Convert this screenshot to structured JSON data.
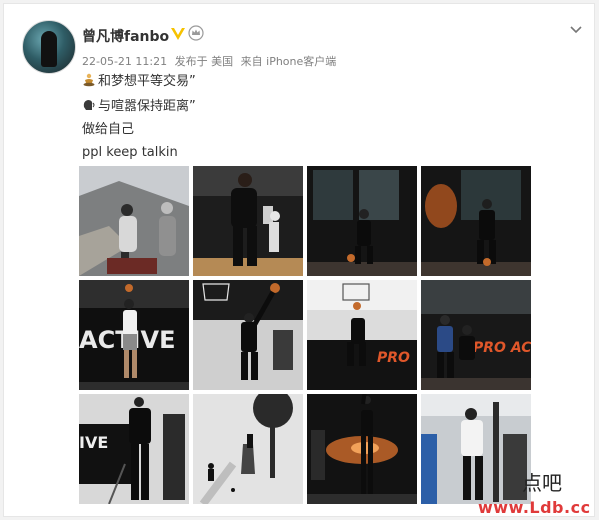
{
  "post": {
    "username": "曾凡博fanbo",
    "meta": {
      "date": "22-05-21 11:21",
      "published_from": "发布于 美国",
      "source": "来自 iPhone客户端"
    },
    "lines": [
      {
        "icon": "meditation-emoji-icon",
        "text": "和梦想平等交易”"
      },
      {
        "icon": "speaking-head-emoji-icon",
        "text": "与喧嚣保持距离”"
      },
      {
        "icon": "",
        "text": "做给自己"
      },
      {
        "icon": "",
        "text": "ppl keep talkin"
      }
    ],
    "photos": [
      {
        "id": "photo-1",
        "text": ""
      },
      {
        "id": "photo-2",
        "text": ""
      },
      {
        "id": "photo-3",
        "text": ""
      },
      {
        "id": "photo-4",
        "text": ""
      },
      {
        "id": "photo-5",
        "text": "ACTIVE"
      },
      {
        "id": "photo-6",
        "text": ""
      },
      {
        "id": "photo-7",
        "text": "PRO"
      },
      {
        "id": "photo-8",
        "text": "PRO AC"
      },
      {
        "id": "photo-9",
        "text": "IVE"
      },
      {
        "id": "photo-10",
        "text": ""
      },
      {
        "id": "photo-11",
        "text": ""
      },
      {
        "id": "photo-12",
        "text": ""
      }
    ]
  },
  "watermark": {
    "text": "www.Ldb.cc",
    "logo_text": "点吧"
  },
  "colors": {
    "verified": "#f6c200",
    "watermark": "#e03a3a",
    "meta": "#808080"
  }
}
